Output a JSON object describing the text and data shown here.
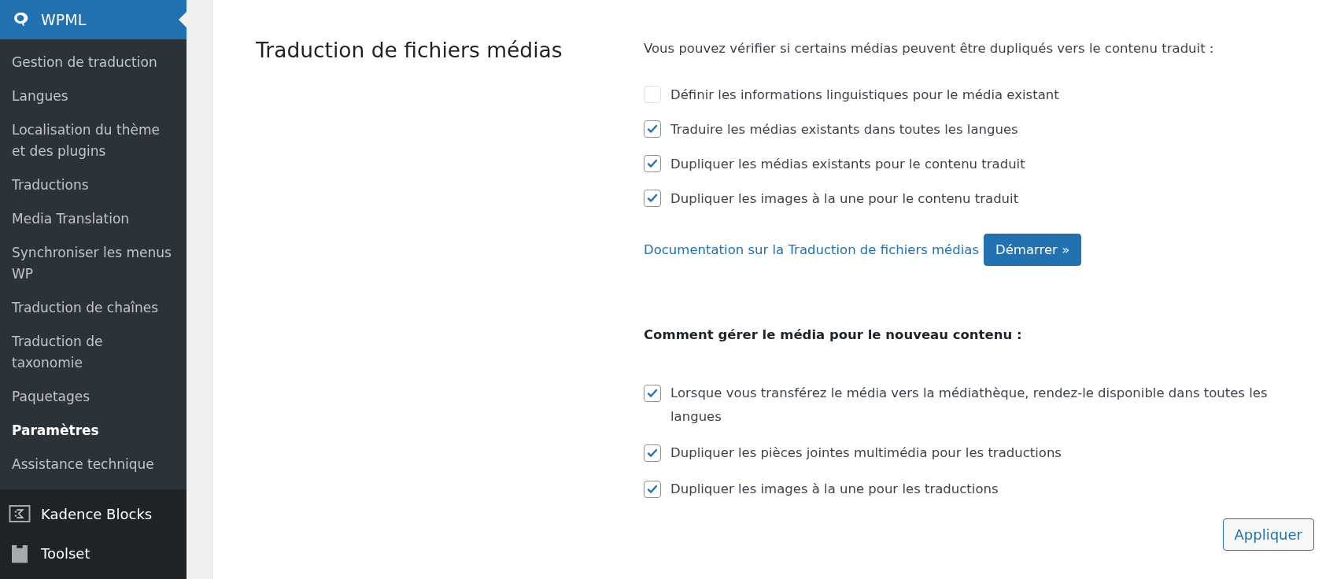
{
  "sidebar": {
    "header": {
      "label": "WPML",
      "selected": true
    },
    "submenu": [
      {
        "label": "Gestion de traduction",
        "selected": false
      },
      {
        "label": "Langues",
        "selected": false
      },
      {
        "label": "Localisation du thème et des plugins",
        "selected": false
      },
      {
        "label": "Traductions",
        "selected": false
      },
      {
        "label": "Media Translation",
        "selected": false
      },
      {
        "label": "Synchroniser les menus WP",
        "selected": false
      },
      {
        "label": "Traduction de chaînes",
        "selected": false
      },
      {
        "label": "Traduction de taxonomie",
        "selected": false
      },
      {
        "label": "Paquetages",
        "selected": false
      },
      {
        "label": "Paramètres",
        "selected": true
      },
      {
        "label": "Assistance technique",
        "selected": false
      }
    ],
    "menu": [
      {
        "label": "Kadence Blocks",
        "kind": "kadence"
      },
      {
        "label": "Toolset",
        "kind": "toolset"
      }
    ]
  },
  "section": {
    "title": "Traduction de fichiers médias",
    "intro": "Vous pouvez vérifier si certains médias peuvent être dupliqués vers le contenu traduit :",
    "options": [
      {
        "label": "Définir les informations linguistiques pour le média existant",
        "checked": false
      },
      {
        "label": "Traduire les médias existants dans toutes les langues",
        "checked": true
      },
      {
        "label": "Dupliquer les médias existants pour le contenu traduit",
        "checked": true
      },
      {
        "label": "Dupliquer les images à la une pour le contenu traduit",
        "checked": true
      }
    ],
    "doc_link": "Documentation sur la Traduction de fichiers médias",
    "start_button": "Démarrer »",
    "new_content_heading": "Comment gérer le média pour le nouveau contenu :",
    "new_content_options": [
      {
        "label": "Lorsque vous transférez le média vers la médiathèque, rendez-le disponible dans toutes les langues",
        "checked": true
      },
      {
        "label": "Dupliquer les pièces jointes multimédia pour les traductions",
        "checked": true
      },
      {
        "label": "Dupliquer les images à la une pour les traductions",
        "checked": true
      }
    ],
    "apply_button": "Appliquer"
  }
}
